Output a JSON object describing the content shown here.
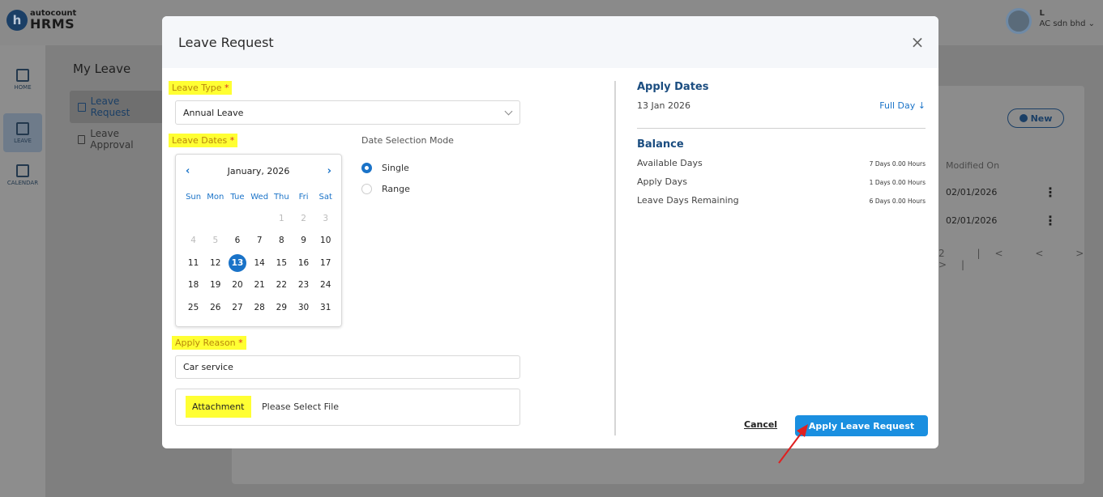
{
  "app": {
    "brand_small": "autocount",
    "brand_big": "HRMS",
    "brand_initial": "h",
    "user_initial": "L",
    "user_company": "AC sdn bhd ⌄"
  },
  "sidebar": {
    "items": [
      {
        "label": "HOME",
        "icon": "home-icon"
      },
      {
        "label": "LEAVE",
        "icon": "leave-icon"
      },
      {
        "label": "CALENDAR",
        "icon": "calendar-icon"
      }
    ]
  },
  "background": {
    "title": "My Leave",
    "menu": [
      "Leave Request",
      "Leave Approval"
    ],
    "new_button": "New",
    "column_modified": "Modified On",
    "rows": [
      "02/01/2026",
      "02/01/2026"
    ],
    "pager_page": "2",
    "pager_controls": "|< < > >|"
  },
  "modal": {
    "title": "Leave Request",
    "leave_type_label": "Leave Type",
    "leave_type_value": "Annual Leave",
    "leave_dates_label": "Leave Dates",
    "calendar": {
      "month": "January, 2026",
      "dow": [
        "Sun",
        "Mon",
        "Tue",
        "Wed",
        "Thu",
        "Fri",
        "Sat"
      ],
      "days": [
        "",
        "",
        "",
        "",
        "1",
        "2",
        "3",
        "4",
        "5",
        "6",
        "7",
        "8",
        "9",
        "10",
        "11",
        "12",
        "13",
        "14",
        "15",
        "16",
        "17",
        "18",
        "19",
        "20",
        "21",
        "22",
        "23",
        "24",
        "25",
        "26",
        "27",
        "28",
        "29",
        "30",
        "31"
      ],
      "selected": "13"
    },
    "date_mode_label": "Date Selection Mode",
    "mode_single": "Single",
    "mode_range": "Range",
    "apply_reason_label": "Apply Reason",
    "apply_reason_value": "Car service",
    "attachment_label": "Attachment",
    "attachment_placeholder": "Please Select File",
    "required_mark": "*"
  },
  "summary": {
    "apply_dates_title": "Apply Dates",
    "apply_date_value": "13 Jan 2026",
    "full_day": "Full Day ↓",
    "balance_title": "Balance",
    "available_label": "Available Days",
    "available_value": "7 Days 0.00 Hours",
    "apply_days_label": "Apply Days",
    "apply_days_value": "1 Days 0.00 Hours",
    "remaining_label": "Leave Days Remaining",
    "remaining_value": "6 Days 0.00 Hours"
  },
  "footer": {
    "cancel": "Cancel",
    "apply": "Apply Leave Request"
  },
  "colors": {
    "accent": "#1a73c8",
    "button": "#1a8fe0",
    "highlight": "#ffff33",
    "arrow": "#e02020"
  }
}
